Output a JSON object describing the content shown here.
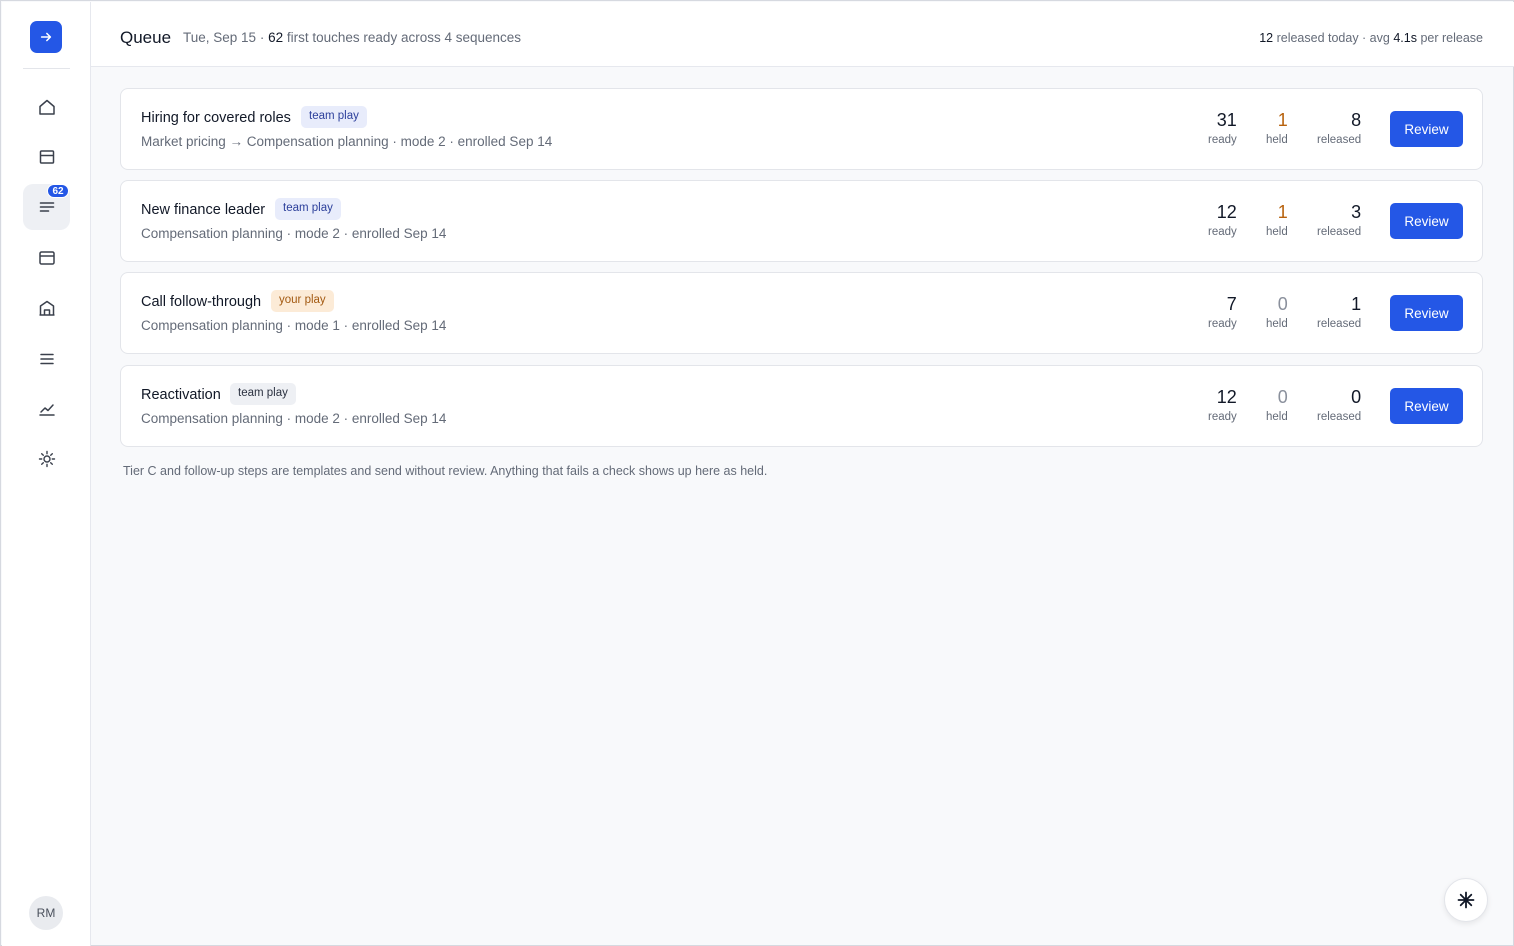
{
  "sidebar": {
    "logo_icon": "arrow-right-icon",
    "nav": [
      {
        "name": "home",
        "icon": "home-icon"
      },
      {
        "name": "inbox",
        "icon": "inbox-icon"
      },
      {
        "name": "queue",
        "icon": "queue-list-icon",
        "badge": "62",
        "active": true
      },
      {
        "name": "calendar",
        "icon": "browser-window-icon"
      },
      {
        "name": "accounts",
        "icon": "building-icon"
      },
      {
        "name": "list",
        "icon": "menu-icon"
      },
      {
        "name": "analytics",
        "icon": "trend-chart-icon"
      },
      {
        "name": "settings",
        "icon": "sun-gear-icon"
      }
    ],
    "user_initials": "RM"
  },
  "header": {
    "title": "Queue",
    "date": "Tue, Sep 15",
    "sep": "·",
    "ready_count": "62",
    "ready_text": "first touches ready across 4 sequences",
    "released_count": "12",
    "released_text": "released today · avg",
    "avg_value": "4.1s",
    "avg_text": "per release"
  },
  "sequences": [
    {
      "title": "Hiring for covered roles",
      "tag": "team play",
      "subtitle": "Market pricing → Compensation planning · mode 2 · enrolled Sep 14",
      "ready": "31",
      "held": "1",
      "released": "8",
      "review": "Review"
    },
    {
      "title": "New finance leader",
      "tag": "team play",
      "subtitle": "Compensation planning · mode 2 · enrolled Sep 14",
      "ready": "12",
      "held": "1",
      "released": "3",
      "review": "Review"
    },
    {
      "title": "Call follow-through",
      "tag": "your play",
      "subtitle": "Compensation planning · mode 1 · enrolled Sep 14",
      "ready": "7",
      "held": "0",
      "released": "1",
      "review": "Review"
    },
    {
      "title": "Reactivation",
      "tag": "team play",
      "subtitle": "Compensation planning · mode 2 · enrolled Sep 14",
      "ready": "12",
      "held": "0",
      "released": "0",
      "review": "Review"
    }
  ],
  "labels": {
    "ready": "ready",
    "held": "held",
    "released": "released"
  },
  "footnote": "Tier C and follow-up steps are templates and send without review. Anything that fails a check shows up here as held.",
  "fab_icon": "sparkle-asterisk-icon",
  "colors": {
    "accent": "#2457e6",
    "held_amber": "#b8620d",
    "team_tag_bg": "#e8ecfb",
    "your_tag_bg": "#fcebd7"
  }
}
